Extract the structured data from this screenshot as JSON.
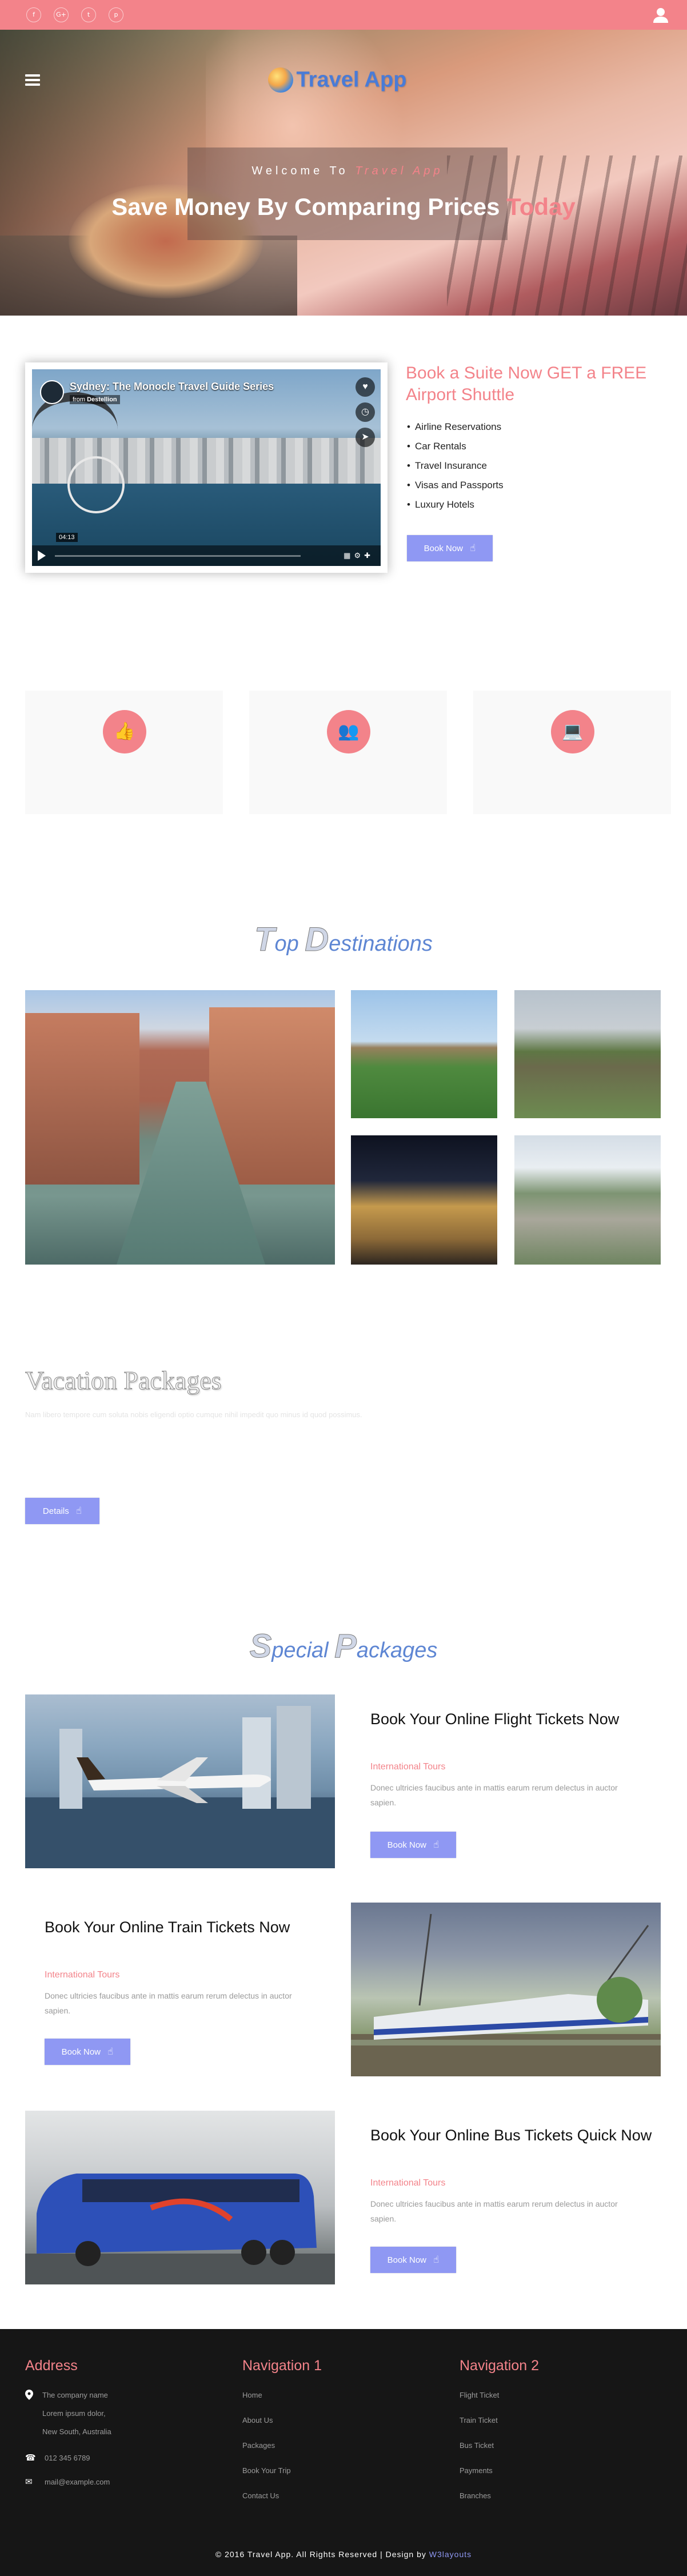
{
  "topbar": {
    "social": [
      {
        "icon": "facebook-icon",
        "glyph": "f"
      },
      {
        "icon": "google-plus-icon",
        "glyph": "G+"
      },
      {
        "icon": "twitter-icon",
        "glyph": "t"
      },
      {
        "icon": "pinterest-icon",
        "glyph": "p"
      }
    ],
    "user_icon": "user-icon"
  },
  "hero": {
    "logo": "Travel App",
    "welcome_prefix": "Welcome To ",
    "welcome_brand": "Travel App",
    "tagline_main": "Save Money By Comparing Prices ",
    "tagline_accent": "Today"
  },
  "video": {
    "title": "Sydney: The Monocle Travel Guide Series",
    "from_label": "from ",
    "from_source": "Destellion",
    "time": "04:13"
  },
  "suite": {
    "title": "Book a Suite Now GET a FREE Airport Shuttle",
    "items": [
      "Airline Reservations",
      "Car Rentals",
      "Travel Insurance",
      "Visas and Passports",
      "Luxury Hotels"
    ],
    "button": "Book Now"
  },
  "features": [
    {
      "icon": "thumbs-up-icon",
      "glyph": "👍"
    },
    {
      "icon": "users-icon",
      "glyph": "👥"
    },
    {
      "icon": "laptop-icon",
      "glyph": "💻"
    }
  ],
  "destinations": {
    "heading_a": "T",
    "heading_b": "op ",
    "heading_c": "D",
    "heading_d": "estinations"
  },
  "vacation": {
    "title": "Vacation Packages",
    "text": "Nam libero tempore cum soluta nobis eligendi optio cumque nihil impedit quo minus id quod possimus.",
    "button": "Details"
  },
  "special": {
    "heading_a": "S",
    "heading_b": "pecial ",
    "heading_c": "P",
    "heading_d": "ackages",
    "packages": [
      {
        "title": "Book Your Online Flight Tickets Now",
        "sub": "International Tours",
        "desc": "Donec ultricies faucibus ante in mattis earum rerum delectus in auctor sapien.",
        "button": "Book Now"
      },
      {
        "title": "Book Your Online Train Tickets Now",
        "sub": "International Tours",
        "desc": "Donec ultricies faucibus ante in mattis earum rerum delectus in auctor sapien.",
        "button": "Book Now"
      },
      {
        "title": "Book Your Online Bus Tickets Quick Now",
        "sub": "International Tours",
        "desc": "Donec ultricies faucibus ante in mattis earum rerum delectus in auctor sapien.",
        "button": "Book Now"
      }
    ]
  },
  "footer": {
    "address": {
      "heading": "Address",
      "lines": [
        "The company name",
        "Lorem ipsum dolor,",
        "New South, Australia"
      ],
      "phone": "012 345 6789",
      "email": "mail@example.com"
    },
    "nav1": {
      "heading": "Navigation 1",
      "links": [
        "Home",
        "About Us",
        "Packages",
        "Book Your Trip",
        "Contact Us"
      ]
    },
    "nav2": {
      "heading": "Navigation 2",
      "links": [
        "Flight Ticket",
        "Train Ticket",
        "Bus Ticket",
        "Payments",
        "Branches"
      ]
    },
    "copyright": "© 2016 Travel App. All Rights Reserved | Design by ",
    "designer": "W3layouts"
  },
  "colors": {
    "accent": "#f3838a",
    "button": "#8f98f3",
    "logo": "#4a7bd6",
    "footer_bg": "#161616"
  }
}
